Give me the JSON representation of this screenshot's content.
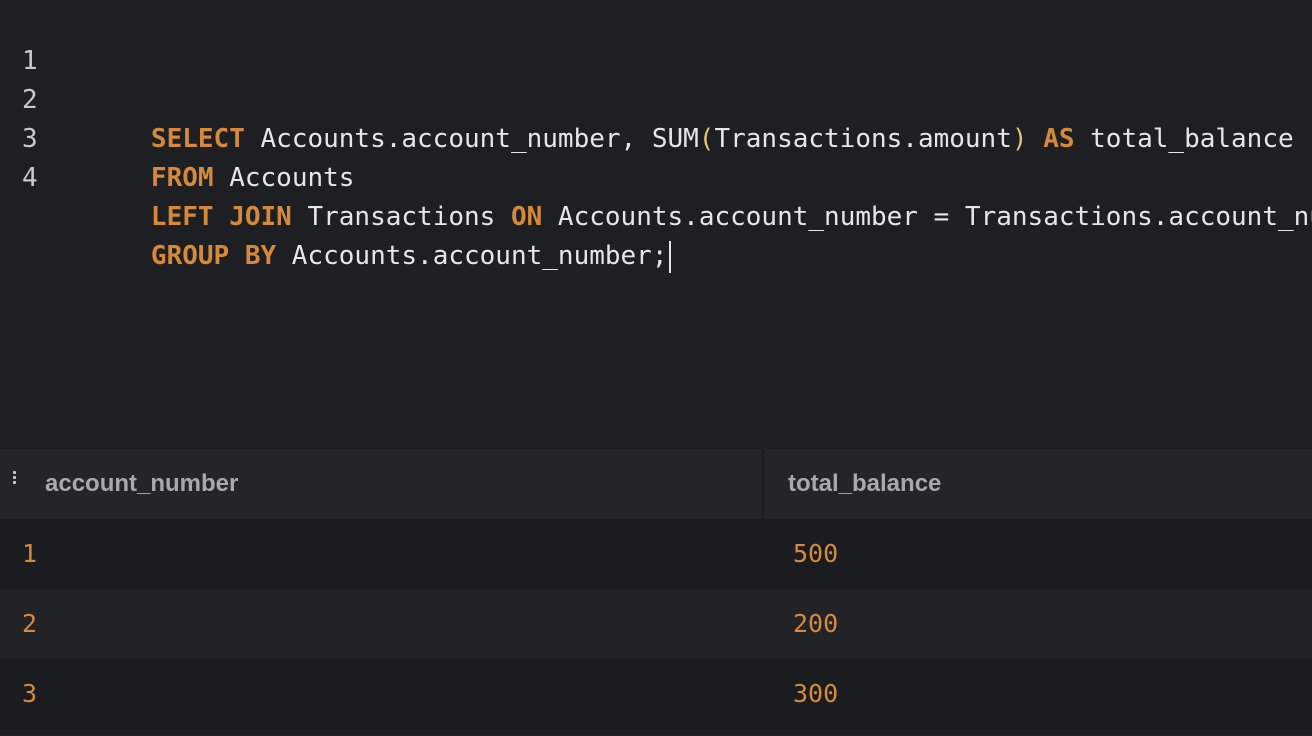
{
  "editor": {
    "lines": [
      {
        "number": "1",
        "tokens": [
          {
            "text": "SELECT",
            "kind": "kw"
          },
          {
            "text": " Accounts.account_number, SUM",
            "kind": "id"
          },
          {
            "text": "(",
            "kind": "paren"
          },
          {
            "text": "Transactions.amount",
            "kind": "id"
          },
          {
            "text": ")",
            "kind": "paren"
          },
          {
            "text": " ",
            "kind": "id"
          },
          {
            "text": "AS",
            "kind": "kw"
          },
          {
            "text": " total_balance",
            "kind": "id"
          }
        ]
      },
      {
        "number": "2",
        "tokens": [
          {
            "text": "FROM",
            "kind": "kw"
          },
          {
            "text": " Accounts",
            "kind": "id"
          }
        ]
      },
      {
        "number": "3",
        "tokens": [
          {
            "text": "LEFT JOIN",
            "kind": "kw"
          },
          {
            "text": " Transactions ",
            "kind": "id"
          },
          {
            "text": "ON",
            "kind": "kw"
          },
          {
            "text": " Accounts.account_number = Transactions.account_number",
            "kind": "id"
          }
        ]
      },
      {
        "number": "4",
        "tokens": [
          {
            "text": "GROUP BY",
            "kind": "kw"
          },
          {
            "text": " Accounts.account_number;",
            "kind": "id"
          }
        ]
      }
    ]
  },
  "results": {
    "menu_icon": "vertical-ellipsis-icon",
    "columns": [
      "account_number",
      "total_balance"
    ],
    "rows": [
      [
        "1",
        "500"
      ],
      [
        "2",
        "200"
      ],
      [
        "3",
        "300"
      ]
    ]
  },
  "colors": {
    "background": "#1e1f22",
    "keyword": "#d6893b",
    "value": "#d6893b",
    "header_text": "#a8a8ad"
  }
}
